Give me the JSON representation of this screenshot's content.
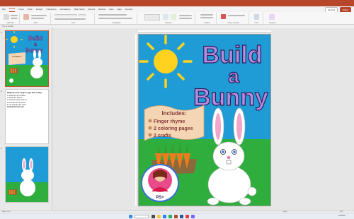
{
  "window": {
    "title": "Build a Bunny - PowerPoint",
    "accent": "#b7472a"
  },
  "ribbon": {
    "tabs": [
      "File",
      "Home",
      "Insert",
      "Draw",
      "Design",
      "Transitions",
      "Animations",
      "Slide Show",
      "Record",
      "Review",
      "View",
      "Help",
      "Acrobat"
    ],
    "active_tab": "Home",
    "record_label": "Record",
    "share_label": "Share",
    "group_labels": [
      "Clipboard",
      "Slides",
      "Font",
      "Paragraph",
      "Drawing",
      "Editing",
      "Adobe Acrobat",
      "Voice",
      "Designer"
    ]
  },
  "quickbar": {
    "text": "Title & Subtitle"
  },
  "thumbnails": [
    {
      "number": "1",
      "title_line1": "Build",
      "title_line2": "a",
      "title_line3": "Bunny",
      "includes": "Includes:"
    },
    {
      "number": "2",
      "heading": "Rhymes and songs to get kids ready:",
      "lines": [
        "1. Read the rhyme aloud",
        "2. Model the actions",
        "3. Invite the class to join in",
        "4. Print the bunny pieces",
        "5. Cut and glue the crafts",
        "Included in this set:"
      ]
    },
    {
      "number": "3"
    }
  ],
  "slide": {
    "title_line1": "Build",
    "title_line2": "a",
    "title_line3": "Bunny",
    "banner_heading": "Includes:",
    "banner_items": [
      "Finger rhyme",
      "2 coloring pages",
      "2 crafts"
    ],
    "logo_text": "PS+",
    "colors": {
      "sky": "#1f9bd6",
      "grass": "#2fae3d",
      "title_fill": "#b48ce0",
      "title_stroke": "#2d1f5c",
      "sun": "#ffd21f",
      "carrot": "#f07b1f",
      "banner": "#f4d6b4"
    }
  },
  "statusbar": {
    "slide_info": "Slide 1 of 3",
    "notes_label": "Notes",
    "zoom": "86%"
  },
  "taskbar": {
    "search_placeholder": "Search",
    "clock": "3:35 PM"
  }
}
